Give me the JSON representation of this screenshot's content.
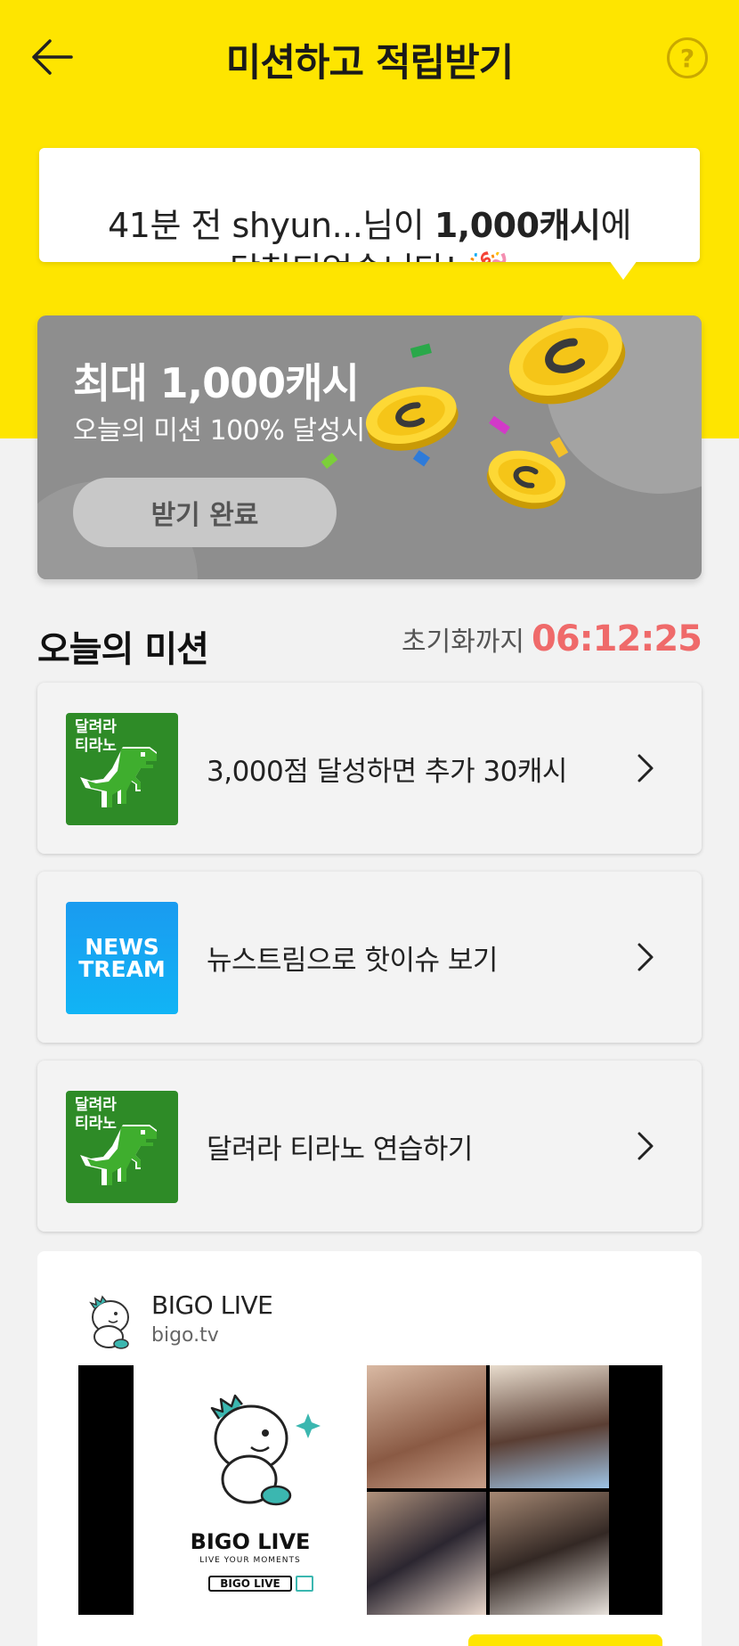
{
  "header": {
    "title": "미션하고 적립받기",
    "help_label": "?"
  },
  "ticker": {
    "prefix": "41분 전 shyun...님이 ",
    "amount": "1,000캐시",
    "suffix": "에",
    "second_line": "당첨되었습니다! 🎉"
  },
  "banner": {
    "title": "최대 1,000캐시",
    "subtitle": "오늘의 미션 100% 달성시",
    "button_label": "받기 완료"
  },
  "missions_section": {
    "title": "오늘의 미션",
    "timer_label": "초기화까지",
    "timer_value": "06:12:25"
  },
  "missions": [
    {
      "label": "3,000점 달성하면 추가 30캐시",
      "thumb_text_1": "달려라",
      "thumb_text_2": "티라노",
      "icon": "dino-game-icon"
    },
    {
      "label": "뉴스트림으로 핫이슈 보기",
      "thumb_text_1": "NEWS",
      "thumb_text_2": "TREAM",
      "icon": "newstream-icon"
    },
    {
      "label": "달려라 티라노 연습하기",
      "thumb_text_1": "달려라",
      "thumb_text_2": "티라노",
      "icon": "dino-game-icon"
    }
  ],
  "ad": {
    "name": "BIGO LIVE",
    "url": "bigo.tv",
    "brand": "BIGO LIVE",
    "tagline": "LIVE YOUR MOMENTS",
    "search_label": "BIGO LIVE"
  },
  "colors": {
    "header_bg": "#fee500",
    "timer": "#ef6a6a",
    "banner_bg": "#8e8e8e"
  }
}
